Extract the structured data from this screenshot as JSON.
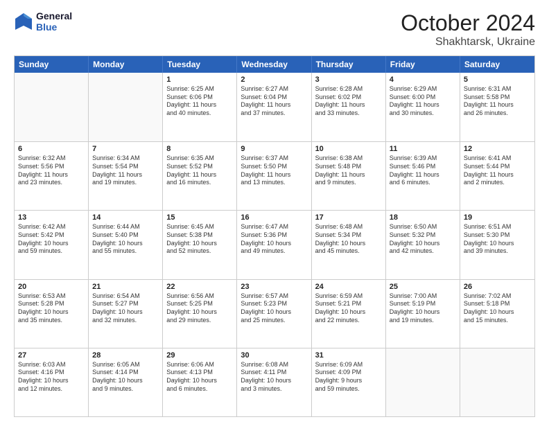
{
  "logo": {
    "line1": "General",
    "line2": "Blue"
  },
  "header": {
    "month": "October 2024",
    "location": "Shakhtarsk, Ukraine"
  },
  "weekdays": [
    "Sunday",
    "Monday",
    "Tuesday",
    "Wednesday",
    "Thursday",
    "Friday",
    "Saturday"
  ],
  "weeks": [
    [
      {
        "day": "",
        "lines": []
      },
      {
        "day": "",
        "lines": []
      },
      {
        "day": "1",
        "lines": [
          "Sunrise: 6:25 AM",
          "Sunset: 6:06 PM",
          "Daylight: 11 hours",
          "and 40 minutes."
        ]
      },
      {
        "day": "2",
        "lines": [
          "Sunrise: 6:27 AM",
          "Sunset: 6:04 PM",
          "Daylight: 11 hours",
          "and 37 minutes."
        ]
      },
      {
        "day": "3",
        "lines": [
          "Sunrise: 6:28 AM",
          "Sunset: 6:02 PM",
          "Daylight: 11 hours",
          "and 33 minutes."
        ]
      },
      {
        "day": "4",
        "lines": [
          "Sunrise: 6:29 AM",
          "Sunset: 6:00 PM",
          "Daylight: 11 hours",
          "and 30 minutes."
        ]
      },
      {
        "day": "5",
        "lines": [
          "Sunrise: 6:31 AM",
          "Sunset: 5:58 PM",
          "Daylight: 11 hours",
          "and 26 minutes."
        ]
      }
    ],
    [
      {
        "day": "6",
        "lines": [
          "Sunrise: 6:32 AM",
          "Sunset: 5:56 PM",
          "Daylight: 11 hours",
          "and 23 minutes."
        ]
      },
      {
        "day": "7",
        "lines": [
          "Sunrise: 6:34 AM",
          "Sunset: 5:54 PM",
          "Daylight: 11 hours",
          "and 19 minutes."
        ]
      },
      {
        "day": "8",
        "lines": [
          "Sunrise: 6:35 AM",
          "Sunset: 5:52 PM",
          "Daylight: 11 hours",
          "and 16 minutes."
        ]
      },
      {
        "day": "9",
        "lines": [
          "Sunrise: 6:37 AM",
          "Sunset: 5:50 PM",
          "Daylight: 11 hours",
          "and 13 minutes."
        ]
      },
      {
        "day": "10",
        "lines": [
          "Sunrise: 6:38 AM",
          "Sunset: 5:48 PM",
          "Daylight: 11 hours",
          "and 9 minutes."
        ]
      },
      {
        "day": "11",
        "lines": [
          "Sunrise: 6:39 AM",
          "Sunset: 5:46 PM",
          "Daylight: 11 hours",
          "and 6 minutes."
        ]
      },
      {
        "day": "12",
        "lines": [
          "Sunrise: 6:41 AM",
          "Sunset: 5:44 PM",
          "Daylight: 11 hours",
          "and 2 minutes."
        ]
      }
    ],
    [
      {
        "day": "13",
        "lines": [
          "Sunrise: 6:42 AM",
          "Sunset: 5:42 PM",
          "Daylight: 10 hours",
          "and 59 minutes."
        ]
      },
      {
        "day": "14",
        "lines": [
          "Sunrise: 6:44 AM",
          "Sunset: 5:40 PM",
          "Daylight: 10 hours",
          "and 55 minutes."
        ]
      },
      {
        "day": "15",
        "lines": [
          "Sunrise: 6:45 AM",
          "Sunset: 5:38 PM",
          "Daylight: 10 hours",
          "and 52 minutes."
        ]
      },
      {
        "day": "16",
        "lines": [
          "Sunrise: 6:47 AM",
          "Sunset: 5:36 PM",
          "Daylight: 10 hours",
          "and 49 minutes."
        ]
      },
      {
        "day": "17",
        "lines": [
          "Sunrise: 6:48 AM",
          "Sunset: 5:34 PM",
          "Daylight: 10 hours",
          "and 45 minutes."
        ]
      },
      {
        "day": "18",
        "lines": [
          "Sunrise: 6:50 AM",
          "Sunset: 5:32 PM",
          "Daylight: 10 hours",
          "and 42 minutes."
        ]
      },
      {
        "day": "19",
        "lines": [
          "Sunrise: 6:51 AM",
          "Sunset: 5:30 PM",
          "Daylight: 10 hours",
          "and 39 minutes."
        ]
      }
    ],
    [
      {
        "day": "20",
        "lines": [
          "Sunrise: 6:53 AM",
          "Sunset: 5:28 PM",
          "Daylight: 10 hours",
          "and 35 minutes."
        ]
      },
      {
        "day": "21",
        "lines": [
          "Sunrise: 6:54 AM",
          "Sunset: 5:27 PM",
          "Daylight: 10 hours",
          "and 32 minutes."
        ]
      },
      {
        "day": "22",
        "lines": [
          "Sunrise: 6:56 AM",
          "Sunset: 5:25 PM",
          "Daylight: 10 hours",
          "and 29 minutes."
        ]
      },
      {
        "day": "23",
        "lines": [
          "Sunrise: 6:57 AM",
          "Sunset: 5:23 PM",
          "Daylight: 10 hours",
          "and 25 minutes."
        ]
      },
      {
        "day": "24",
        "lines": [
          "Sunrise: 6:59 AM",
          "Sunset: 5:21 PM",
          "Daylight: 10 hours",
          "and 22 minutes."
        ]
      },
      {
        "day": "25",
        "lines": [
          "Sunrise: 7:00 AM",
          "Sunset: 5:19 PM",
          "Daylight: 10 hours",
          "and 19 minutes."
        ]
      },
      {
        "day": "26",
        "lines": [
          "Sunrise: 7:02 AM",
          "Sunset: 5:18 PM",
          "Daylight: 10 hours",
          "and 15 minutes."
        ]
      }
    ],
    [
      {
        "day": "27",
        "lines": [
          "Sunrise: 6:03 AM",
          "Sunset: 4:16 PM",
          "Daylight: 10 hours",
          "and 12 minutes."
        ]
      },
      {
        "day": "28",
        "lines": [
          "Sunrise: 6:05 AM",
          "Sunset: 4:14 PM",
          "Daylight: 10 hours",
          "and 9 minutes."
        ]
      },
      {
        "day": "29",
        "lines": [
          "Sunrise: 6:06 AM",
          "Sunset: 4:13 PM",
          "Daylight: 10 hours",
          "and 6 minutes."
        ]
      },
      {
        "day": "30",
        "lines": [
          "Sunrise: 6:08 AM",
          "Sunset: 4:11 PM",
          "Daylight: 10 hours",
          "and 3 minutes."
        ]
      },
      {
        "day": "31",
        "lines": [
          "Sunrise: 6:09 AM",
          "Sunset: 4:09 PM",
          "Daylight: 9 hours",
          "and 59 minutes."
        ]
      },
      {
        "day": "",
        "lines": []
      },
      {
        "day": "",
        "lines": []
      }
    ]
  ]
}
